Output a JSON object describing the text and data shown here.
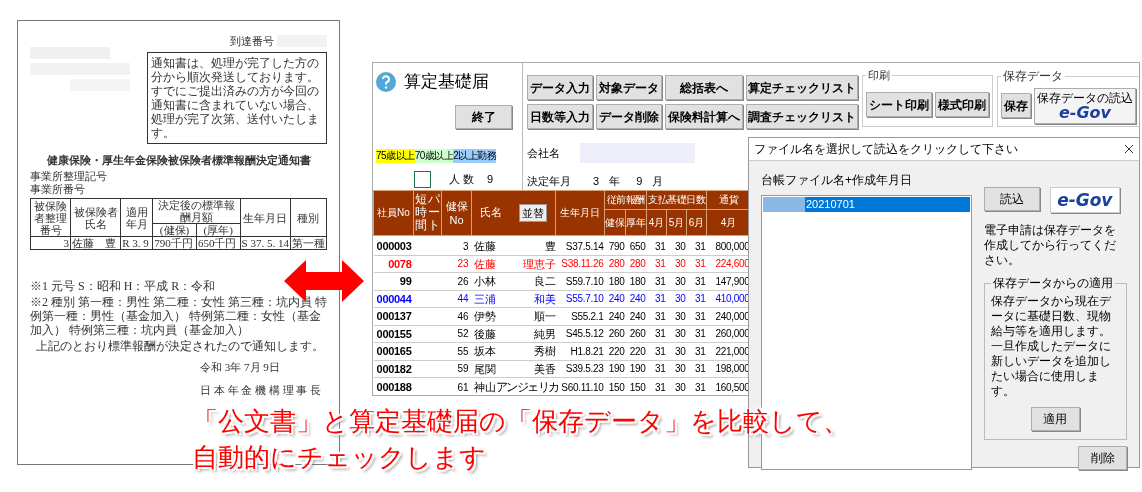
{
  "document": {
    "receipt_label": "到達番号",
    "notice": "通知書は、処理が完了した方の分から順次発送しております。すでにご提出済みの方が今回の通知書に含まれていない場合、処理が完了次第、送付いたします。",
    "title": "健康保険・厚生年金保険被保険者標準報酬決定通知書",
    "office_labels": [
      "事業所整理記号",
      "事業所番号"
    ],
    "columns": [
      "被保険者整理番号",
      "被保険者氏名",
      "適用年月",
      "決定後の標準報酬月額",
      "(健保)",
      "(厚年)",
      "生年月日",
      "種別"
    ],
    "row": [
      "3",
      "佐藤　豊",
      "R 3. 9",
      "790千円",
      "650千円",
      "S 37. 5. 14",
      "第一種"
    ],
    "footnotes": [
      "※1 元号 S：昭和 H：平成 R：令和",
      "※2 種別 第一種：男性 第二種：女性 第三種：坑内員 特例第一種：男性（基金加入） 特例第二種：女性（基金加入） 特例第三種：坑内員（基金加入）"
    ],
    "statement": "上記のとおり標準報酬が決定されたので通知します。",
    "date": "令和 3年 7月 9日",
    "issuer": "日 本 年 金 機 構 理 事 長"
  },
  "sheet": {
    "title": "算定基礎届",
    "exit_button": "終了",
    "buttons": [
      [
        "データ入力",
        "対象データ",
        "総括表へ",
        "算定チェックリスト"
      ],
      [
        "日数等入力",
        "データ削除",
        "保険料計算へ",
        "調査チェックリスト"
      ]
    ],
    "print_group": {
      "label": "印刷",
      "buttons": [
        "シート印刷",
        "様式印刷"
      ]
    },
    "save_group": {
      "label": "保存データ",
      "save_button": "保存",
      "egov_caption": "保存データの読込",
      "egov_logo": "e-Gov"
    },
    "legend": [
      {
        "label": "75歳以上",
        "color": "#ffff00"
      },
      {
        "label": "70歳以上",
        "color": "#ccffcc"
      },
      {
        "label": "2以上勤務",
        "color": "#99ccff"
      }
    ],
    "company_label": "会社名",
    "headcount_label": "人数",
    "headcount": "9",
    "decision_label": "決定年月",
    "decision_year": "3",
    "year_unit": "年",
    "decision_month": "9",
    "month_unit": "月",
    "table": {
      "employee_no": "社員No",
      "part_time": [
        "短時間",
        "パート"
      ],
      "insurance_no": [
        "健保",
        "No"
      ],
      "name": "氏名",
      "sort_button": "並替",
      "birth_date": "生年月日",
      "groups": [
        {
          "label": "従前報酬",
          "columns": [
            "健保",
            "厚年"
          ]
        },
        {
          "label": "支払基礎日数",
          "columns": [
            "4月",
            "5月",
            "6月"
          ]
        },
        {
          "label": "通貨",
          "columns": [
            "4月"
          ]
        }
      ],
      "rows": [
        {
          "color": "#000000",
          "cells": [
            "000003",
            "3",
            "佐藤",
            "豊",
            "S37.5.14",
            "790",
            "650",
            "31",
            "30",
            "31",
            "800,000"
          ]
        },
        {
          "color": "#ff0000",
          "cells": [
            "0078",
            "23",
            "佐藤",
            "理恵子",
            "S38.11.26",
            "280",
            "280",
            "31",
            "30",
            "31",
            "224,600"
          ]
        },
        {
          "color": "#000000",
          "cells": [
            "99",
            "26",
            "小林",
            "良二",
            "S59.7.10",
            "180",
            "180",
            "31",
            "30",
            "31",
            "147,900"
          ]
        },
        {
          "color": "#0000ff",
          "cells": [
            "000044",
            "44",
            "三浦",
            "和美",
            "S55.7.10",
            "240",
            "240",
            "31",
            "30",
            "31",
            "410,000"
          ]
        },
        {
          "color": "#000000",
          "cells": [
            "000137",
            "46",
            "伊勢",
            "順一",
            "S55.2.1",
            "240",
            "240",
            "31",
            "30",
            "31",
            "240,000"
          ]
        },
        {
          "color": "#000000",
          "cells": [
            "000155",
            "52",
            "後藤",
            "純男",
            "S45.5.12",
            "260",
            "260",
            "31",
            "30",
            "31",
            "260,000"
          ]
        },
        {
          "color": "#000000",
          "cells": [
            "000165",
            "55",
            "坂本",
            "秀樹",
            "H1.8.21",
            "220",
            "220",
            "31",
            "30",
            "31",
            "221,000"
          ]
        },
        {
          "color": "#000000",
          "cells": [
            "000182",
            "59",
            "尾関",
            "美香",
            "S39.5.23",
            "190",
            "190",
            "31",
            "30",
            "31",
            "198,000"
          ]
        },
        {
          "color": "#000000",
          "cells": [
            "000188",
            "61",
            "神山",
            "アンジェリカ",
            "S60.11.10",
            "150",
            "150",
            "31",
            "30",
            "31",
            "160,500"
          ]
        }
      ]
    }
  },
  "dialog": {
    "title": "ファイル名を選択して読込をクリックして下さい",
    "list_label": "台帳ファイル名+作成年月日",
    "files": [
      {
        "name": "20210701",
        "selected": true
      }
    ],
    "load_button": "読込",
    "egov_logo": "e-Gov",
    "note": "電子申請は保存データを作成してから行ってください。",
    "apply_group": {
      "label": "保存データからの適用",
      "text": "保存データから現在データに基礎日数、現物給与等を適用します。一旦作成したデータに新しいデータを追加したい場合に使用します。",
      "button": "適用"
    },
    "delete_button": "削除"
  },
  "caption": {
    "lines": [
      "「公文書」と算定基礎届の「保存データ」を比較して、",
      "自動的にチェックします"
    ]
  }
}
